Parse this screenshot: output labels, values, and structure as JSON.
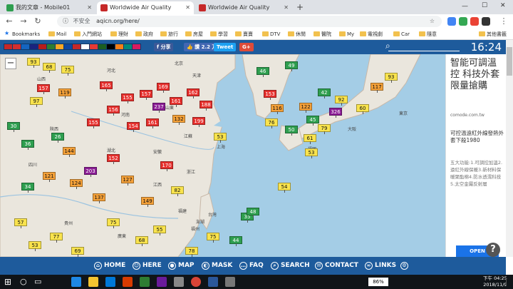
{
  "tabs": [
    {
      "title": "我的文章 - Mobile01",
      "active": false
    },
    {
      "title": "Worldwide Air Quality",
      "active": true
    },
    {
      "title": "Worldwide Air Quality",
      "active": false
    }
  ],
  "new_tab": "+",
  "window_controls": {
    "minimize": "—",
    "maximize": "☐",
    "close": "✕"
  },
  "toolbar": {
    "back": "←",
    "forward": "→",
    "reload": "↻",
    "security": "不安全",
    "url": "aqicn.org/here/",
    "star": "☆",
    "menu": "⋮"
  },
  "bookmarks": {
    "apps_label": "Bookmarks",
    "items": [
      "Mail",
      "入門網站",
      "理財",
      "政府",
      "旅行",
      "房屋",
      "學習",
      "賣賣",
      "DTV",
      "休閒",
      "醫院",
      "My",
      "電視劇",
      "Car",
      "隨意",
      "其他書籤"
    ]
  },
  "header": {
    "share_label": "f 分享",
    "like_label": "👍 讚 2.2 万",
    "tweet_label": "Tweet",
    "gplus_label": "G+",
    "clock": "16:24"
  },
  "map": {
    "zoom_out": "−",
    "places": [
      "山西",
      "河北",
      "北京",
      "天津",
      "山東",
      "河南",
      "江蘇",
      "安徽",
      "上海",
      "湖北",
      "浙江",
      "江西",
      "福建",
      "台灣",
      "廣東",
      "貴州",
      "四川",
      "陝西",
      "首爾",
      "東京",
      "大阪",
      "福岡",
      "福州",
      "澎湖"
    ],
    "stations": [
      {
        "v": 93,
        "c": "#f9e34d"
      },
      {
        "v": 68,
        "c": "#f9e34d"
      },
      {
        "v": 75,
        "c": "#f9e34d"
      },
      {
        "v": 157,
        "c": "#e6302d"
      },
      {
        "v": 119,
        "c": "#f5a139"
      },
      {
        "v": 165,
        "c": "#e6302d"
      },
      {
        "v": 155,
        "c": "#e6302d"
      },
      {
        "v": 157,
        "c": "#e6302d"
      },
      {
        "v": 169,
        "c": "#e6302d"
      },
      {
        "v": 237,
        "c": "#8a1c94"
      },
      {
        "v": 161,
        "c": "#e6302d"
      },
      {
        "v": 162,
        "c": "#e6302d"
      },
      {
        "v": 188,
        "c": "#e6302d"
      },
      {
        "v": 156,
        "c": "#e6302d"
      },
      {
        "v": 155,
        "c": "#e6302d"
      },
      {
        "v": 154,
        "c": "#e6302d"
      },
      {
        "v": 161,
        "c": "#e6302d"
      },
      {
        "v": 132,
        "c": "#f5a139"
      },
      {
        "v": 199,
        "c": "#e6302d"
      },
      {
        "v": 203,
        "c": "#8a1c94"
      },
      {
        "v": 144,
        "c": "#f5a139"
      },
      {
        "v": 152,
        "c": "#e6302d"
      },
      {
        "v": 121,
        "c": "#f5a139"
      },
      {
        "v": 124,
        "c": "#f5a139"
      },
      {
        "v": 137,
        "c": "#f5a139"
      },
      {
        "v": 127,
        "c": "#f5a139"
      },
      {
        "v": 149,
        "c": "#f5a139"
      },
      {
        "v": 170,
        "c": "#e6302d"
      },
      {
        "v": 82,
        "c": "#f9e34d"
      },
      {
        "v": 75,
        "c": "#f9e34d"
      },
      {
        "v": 57,
        "c": "#f9e34d"
      },
      {
        "v": 53,
        "c": "#f9e34d"
      },
      {
        "v": 77,
        "c": "#f9e34d"
      },
      {
        "v": 69,
        "c": "#f9e34d"
      },
      {
        "v": 68,
        "c": "#f9e34d"
      },
      {
        "v": 55,
        "c": "#f9e34d"
      },
      {
        "v": 35,
        "c": "#2e9e4f"
      },
      {
        "v": 34,
        "c": "#2e9e4f"
      },
      {
        "v": 26,
        "c": "#2e9e4f"
      },
      {
        "v": 46,
        "c": "#2e9e4f"
      },
      {
        "v": 49,
        "c": "#2e9e4f"
      },
      {
        "v": 42,
        "c": "#2e9e4f"
      },
      {
        "v": 50,
        "c": "#2e9e4f"
      },
      {
        "v": 45,
        "c": "#2e9e4f"
      },
      {
        "v": 30,
        "c": "#2e9e4f"
      },
      {
        "v": 97,
        "c": "#f9e34d"
      },
      {
        "v": 153,
        "c": "#e6302d"
      },
      {
        "v": 116,
        "c": "#f5a139"
      },
      {
        "v": 122,
        "c": "#f5a139"
      },
      {
        "v": 92,
        "c": "#f9e34d"
      },
      {
        "v": 326,
        "c": "#8a1c94"
      },
      {
        "v": 117,
        "c": "#f5a139"
      },
      {
        "v": 93,
        "c": "#f9e34d"
      },
      {
        "v": 61,
        "c": "#f9e34d"
      },
      {
        "v": 79,
        "c": "#f9e34d"
      },
      {
        "v": 60,
        "c": "#f9e34d"
      },
      {
        "v": 53,
        "c": "#f9e34d"
      },
      {
        "v": 54,
        "c": "#f9e34d"
      },
      {
        "v": 78,
        "c": "#f9e34d"
      },
      {
        "v": 75,
        "c": "#f9e34d"
      },
      {
        "v": 76,
        "c": "#f9e34d"
      },
      {
        "v": 44,
        "c": "#2e9e4f"
      },
      {
        "v": 48,
        "c": "#2e9e4f"
      },
      {
        "v": 36,
        "c": "#2e9e4f"
      },
      {
        "v": 53,
        "c": "#f9e34d"
      }
    ]
  },
  "ad": {
    "title": "智能可調溫控 科技外套 限量搶購",
    "domain": "comode.com.tw",
    "desc": "可控溫遠紅外線發熱外套下殺1980",
    "body": "五大功能:1.可調控加溫2.遠紅外線保暖3.新材料保暖聚酯棉4.防水透濕科技5.太空金屬反射層",
    "open_label": "OPEN",
    "help": "?"
  },
  "bottom_nav": [
    {
      "label": "HOME",
      "icon": "home-icon"
    },
    {
      "label": "HERE",
      "icon": "person-icon"
    },
    {
      "label": "MAP",
      "icon": "map-pin-icon"
    },
    {
      "label": "MASK",
      "icon": "mask-icon"
    },
    {
      "label": "FAQ",
      "icon": "chat-icon"
    },
    {
      "label": "SEARCH",
      "icon": "search-icon"
    },
    {
      "label": "CONTACT",
      "icon": "mail-icon"
    },
    {
      "label": "LINKS",
      "icon": "link-icon"
    },
    {
      "label": "",
      "icon": "gear-icon"
    }
  ],
  "taskbar": {
    "battery": "86%",
    "time": "下午 04:25",
    "date": "2018/11/9"
  },
  "colors": {
    "header_blue": "#1e5b9c",
    "sea": "#a4cde6",
    "land": "#eae6dd",
    "good": "#2e9e4f",
    "moderate": "#f9e34d",
    "sensitive": "#f5a139",
    "unhealthy": "#e6302d",
    "very_unhealthy": "#8a1c94",
    "hazardous": "#7a1a2a"
  }
}
